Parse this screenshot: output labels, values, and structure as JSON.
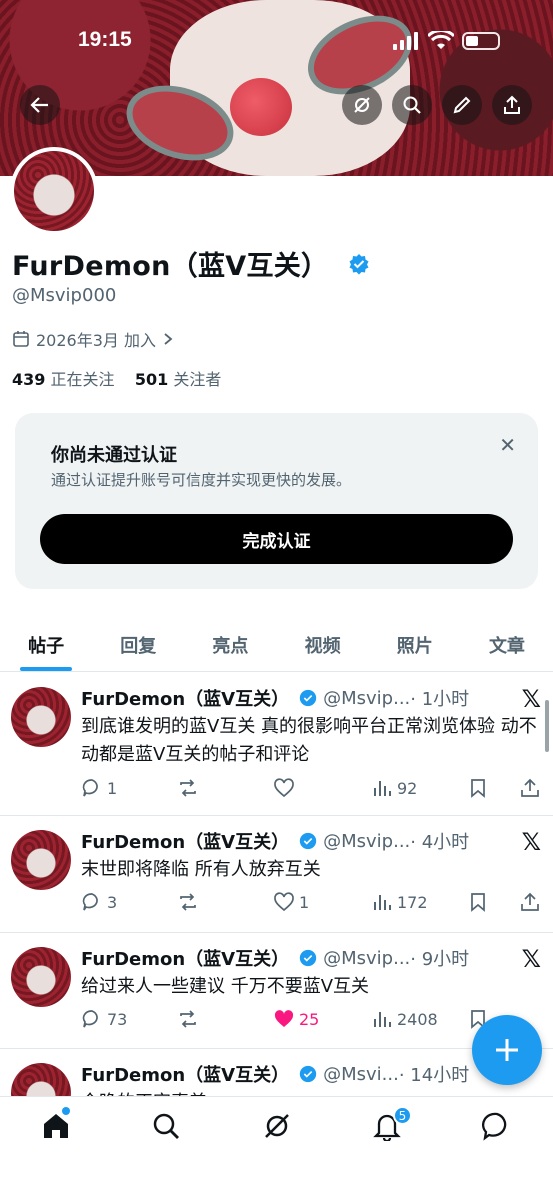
{
  "status": {
    "time": "19:15"
  },
  "profile": {
    "name": "FurDemon（蓝V互关）",
    "handle": "@Msvip000",
    "joined": "2026年3月 加入",
    "following_count": "439",
    "following_label": "正在关注",
    "followers_count": "501",
    "followers_label": "关注者"
  },
  "verify_card": {
    "title": "你尚未通过认证",
    "description": "通过认证提升账号可信度并实现更快的发展。",
    "button": "完成认证"
  },
  "tabs": [
    {
      "label": "帖子",
      "active": true
    },
    {
      "label": "回复"
    },
    {
      "label": "亮点"
    },
    {
      "label": "视频"
    },
    {
      "label": "照片"
    },
    {
      "label": "文章"
    }
  ],
  "posts": [
    {
      "name": "FurDemon（蓝V互关）",
      "handle": "@Msvip...",
      "time": "· 1小时",
      "text": "到底谁发明的蓝V互关 真的很影响平台正常浏览体验 动不动都是蓝V互关的帖子和评论",
      "replies": "1",
      "reposts": "",
      "likes": "",
      "views": "92"
    },
    {
      "name": "FurDemon（蓝V互关）",
      "handle": "@Msvip...",
      "time": "· 4小时",
      "text": "末世即将降临 所有人放弃互关",
      "replies": "3",
      "reposts": "",
      "likes": "1",
      "views": "172"
    },
    {
      "name": "FurDemon（蓝V互关）",
      "handle": "@Msvip...",
      "time": "· 9小时",
      "text": "给过来人一些建议 千万不要蓝V互关",
      "replies": "73",
      "reposts": "",
      "likes": "25",
      "views": "2408"
    },
    {
      "name": "FurDemon（蓝V互关）",
      "handle": "@Msvi...",
      "time": "· 14小时",
      "text": "今晚的正字真美"
    }
  ],
  "notifications_badge": "5",
  "icons": {
    "back": "back-arrow-icon",
    "grok": "grok-icon",
    "search": "search-icon",
    "edit": "edit-icon",
    "share": "share-icon",
    "x_logo": "x-logo-icon"
  },
  "colors": {
    "accent": "#1d9bf0",
    "like": "#f91880"
  }
}
